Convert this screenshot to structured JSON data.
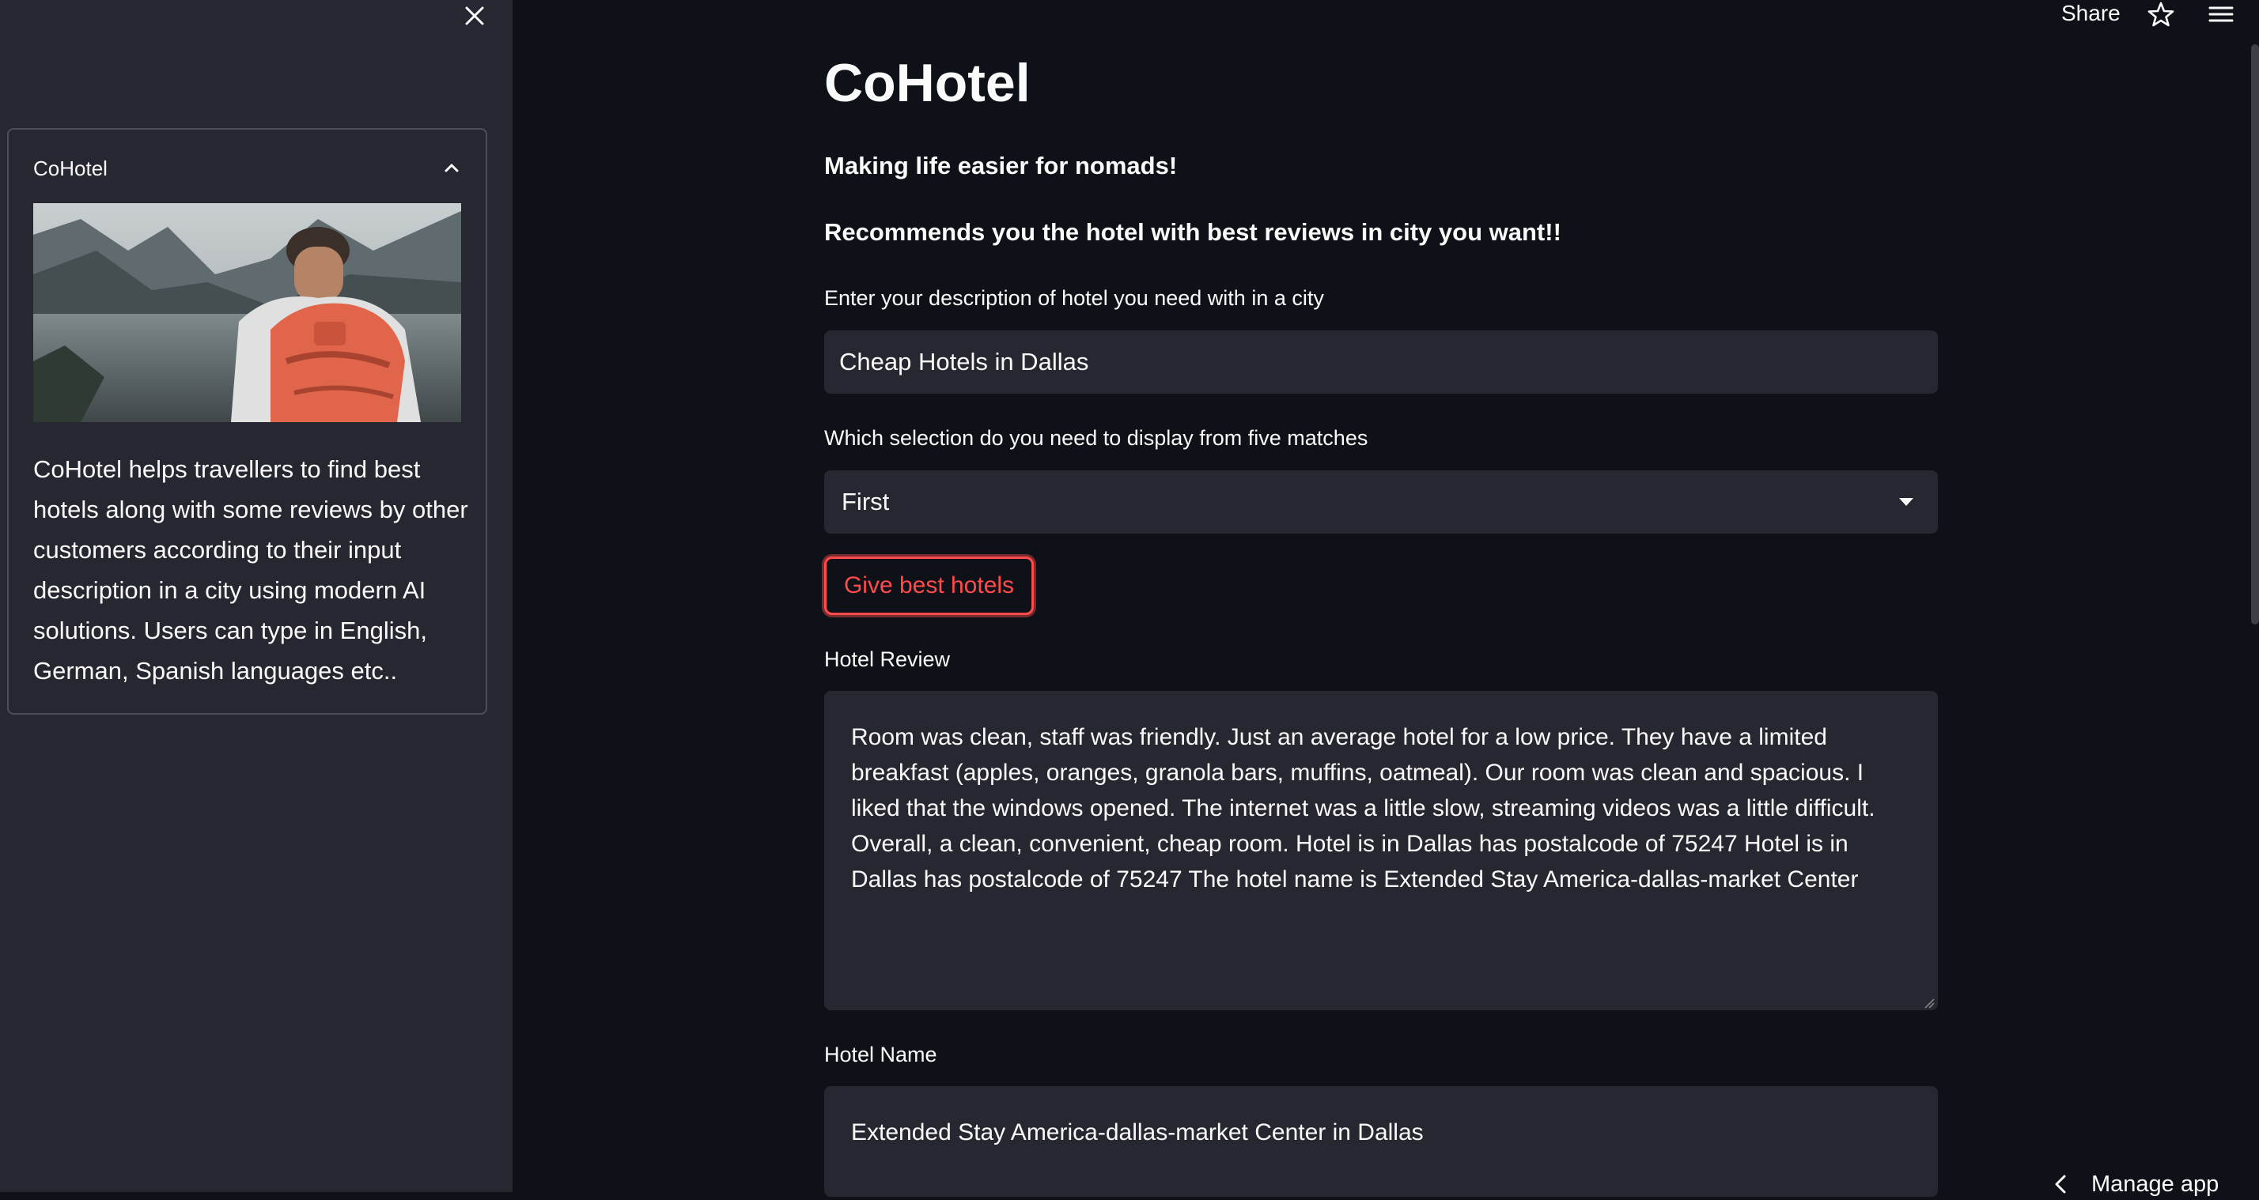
{
  "sidebar": {
    "close_icon": "close-icon",
    "expander": {
      "title": "CoHotel",
      "chevron_icon": "chevron-up-icon",
      "image_alt": "traveller with orange backpack looking at a lake",
      "description": "CoHotel helps travellers to find best hotels along with some reviews by other customers according to their input description in a city using modern AI solutions. Users can type in English, German, Spanish languages etc.."
    }
  },
  "toolbar": {
    "share_label": "Share",
    "star_icon": "star-icon",
    "menu_icon": "hamburger-menu-icon"
  },
  "main": {
    "title": "CoHotel",
    "tagline_1": "Making life easier for nomads!",
    "tagline_2": "Recommends you the hotel with best reviews in city you want!!",
    "description_field": {
      "label": "Enter your description of hotel you need with in a city",
      "value": "Cheap Hotels in Dallas"
    },
    "selection_field": {
      "label": "Which selection do you need to display from five matches",
      "value": "First"
    },
    "submit_button": "Give best hotels",
    "review_field": {
      "label": "Hotel Review",
      "value": "Room was clean, staff was friendly. Just an average hotel for a low price. They have a limited breakfast (apples, oranges, granola bars, muffins, oatmeal). Our room was clean and spacious. I liked that the windows opened. The internet was a little slow, streaming videos was a little difficult. Overall, a clean, convenient, cheap room. Hotel is in Dallas has postalcode of 75247 Hotel is in Dallas has postalcode of 75247 The hotel name is Extended Stay America-dallas-market Center"
    },
    "hotel_name_field": {
      "label": "Hotel Name",
      "value": "Extended Stay America-dallas-market Center in Dallas"
    }
  },
  "footer": {
    "manage_app_label": "Manage app"
  },
  "colors": {
    "background": "#0e1117",
    "sidebar": "#262730",
    "input_bg": "#262730",
    "accent": "#ff4b4b",
    "text": "#fafafa"
  }
}
